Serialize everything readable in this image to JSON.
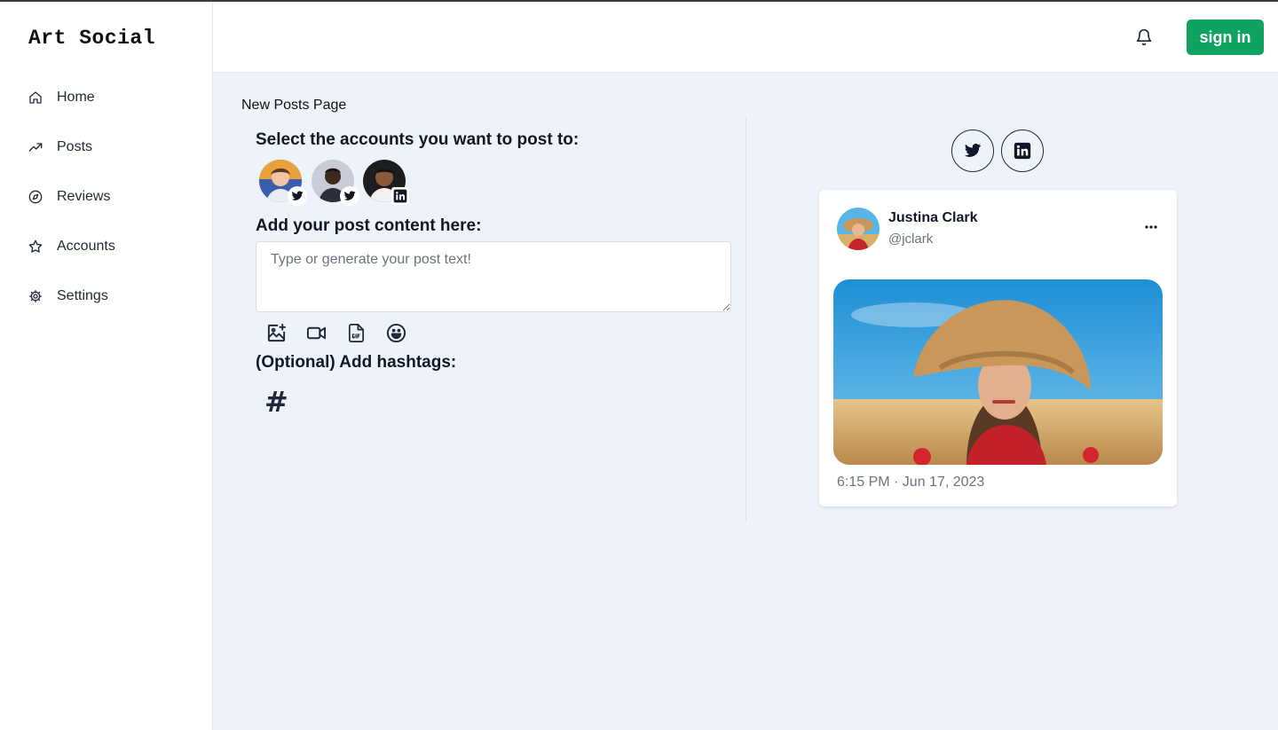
{
  "app": {
    "brand": "Art Social"
  },
  "sidebar": {
    "items": [
      {
        "label": "Home",
        "icon": "home-icon"
      },
      {
        "label": "Posts",
        "icon": "trending-up-icon"
      },
      {
        "label": "Reviews",
        "icon": "compass-icon"
      },
      {
        "label": "Accounts",
        "icon": "star-icon"
      },
      {
        "label": "Settings",
        "icon": "gear-icon"
      }
    ]
  },
  "header": {
    "signin_label": "sign in",
    "accent": "#0ea360"
  },
  "main": {
    "breadcrumb": "New Posts Page",
    "select_accounts_label": "Select the accounts you want to post to:",
    "accounts": [
      {
        "network": "twitter"
      },
      {
        "network": "twitter"
      },
      {
        "network": "linkedin"
      }
    ],
    "content_label": "Add your post content here:",
    "content_placeholder": "Type or generate your post text!",
    "hashtags_label": "(Optional) Add hashtags:",
    "hashtag_symbol": "#"
  },
  "preview": {
    "networks": [
      "twitter",
      "linkedin"
    ],
    "author_name": "Justina Clark",
    "author_handle": "@jclark",
    "timestamp": "6:15 PM · Jun 17, 2023"
  }
}
